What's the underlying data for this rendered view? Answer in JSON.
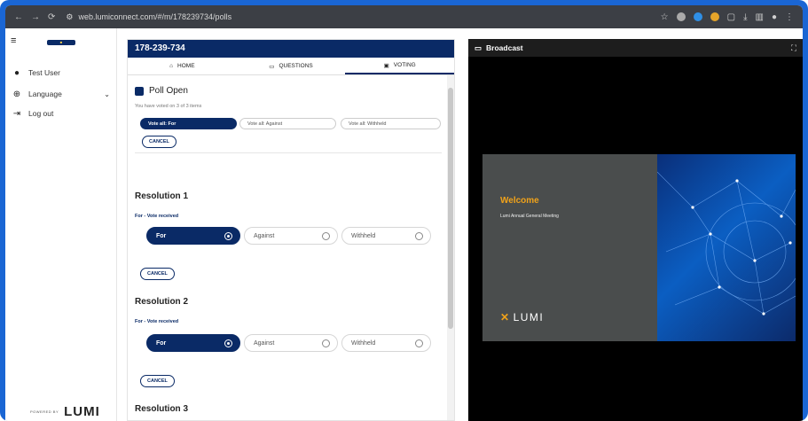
{
  "browser": {
    "url": "web.lumiconnect.com/#/m/178239734/polls",
    "nav_icons": [
      "back-icon",
      "forward-icon",
      "reload-icon"
    ]
  },
  "sidebar": {
    "items": [
      {
        "label": "Test User",
        "icon": "user-icon"
      },
      {
        "label": "Language",
        "icon": "globe-icon"
      },
      {
        "label": "Log out",
        "icon": "logout-icon"
      }
    ],
    "powered_small": "POWERED BY",
    "powered_logo": "LUMI"
  },
  "meeting": {
    "id": "178-239-734",
    "tabs": [
      {
        "label": "HOME",
        "icon": "home-icon"
      },
      {
        "label": "QUESTIONS",
        "icon": "chat-icon"
      },
      {
        "label": "VOTING",
        "icon": "chart-icon"
      }
    ],
    "active_tab": "VOTING"
  },
  "poll": {
    "title": "Poll Open",
    "voted_text": "You have voted on 3 of 3 items",
    "vote_all": [
      "Vote all: For",
      "Vote all: Against",
      "Vote all: Withheld"
    ],
    "vote_all_selected": "Vote all: For",
    "cancel_label": "CANCEL",
    "resolutions": [
      {
        "title": "Resolution 1",
        "status": "For - Vote received",
        "options": [
          "For",
          "Against",
          "Withheld"
        ],
        "selected": "For"
      },
      {
        "title": "Resolution 2",
        "status": "For - Vote received",
        "options": [
          "For",
          "Against",
          "Withheld"
        ],
        "selected": "For"
      },
      {
        "title": "Resolution 3"
      }
    ]
  },
  "broadcast": {
    "title": "Broadcast",
    "slide": {
      "welcome": "Welcome",
      "subtitle": "Lumi Annual General Meeting",
      "logo": "LUMI"
    },
    "colors": {
      "accent": "#f0a21a",
      "navy": "#0a2a66"
    }
  }
}
